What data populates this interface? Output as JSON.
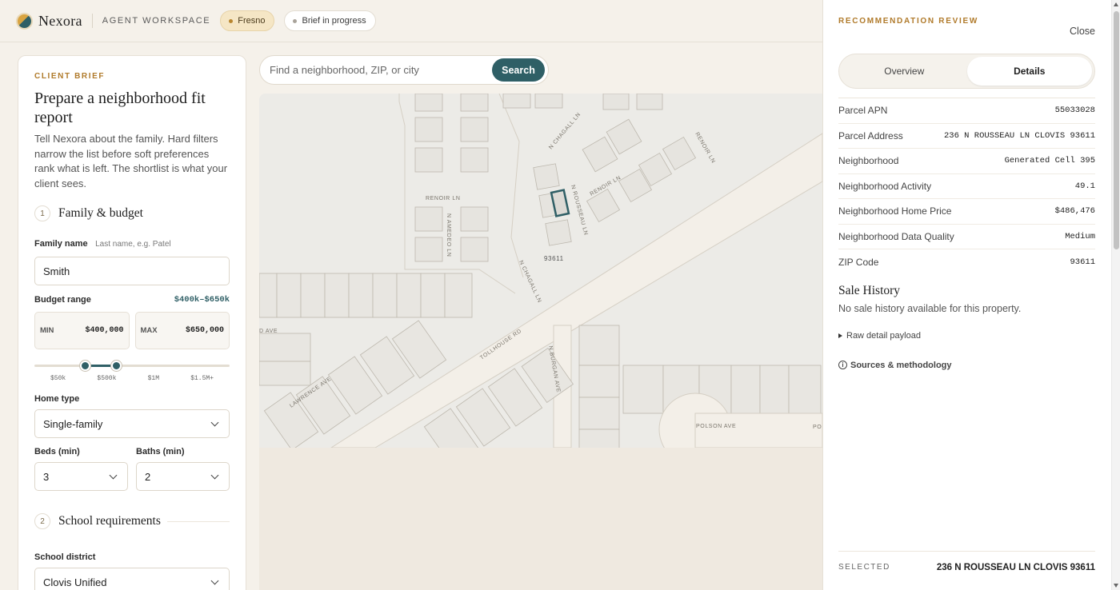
{
  "topbar": {
    "brand": "Nexora",
    "workspace": "AGENT WORKSPACE",
    "city_pill": "Fresno",
    "status_pill": "Brief in progress"
  },
  "brief": {
    "eyebrow": "CLIENT BRIEF",
    "title": "Prepare a neighborhood fit report",
    "description": "Tell Nexora about the family. Hard filters narrow the list before soft preferences rank what is left. The shortlist is what your client sees.",
    "section1": {
      "num": "1",
      "title": "Family & budget"
    },
    "family_name": {
      "label": "Family name",
      "hint": "Last name, e.g. Patel",
      "value": "Smith"
    },
    "budget": {
      "label": "Budget range",
      "summary": "$400k–$650k",
      "min_label": "MIN",
      "min_value": "$400,000",
      "max_label": "MAX",
      "max_value": "$650,000",
      "ticks": [
        "$50k",
        "$500k",
        "$1M",
        "$1.5M+"
      ]
    },
    "home_type": {
      "label": "Home type",
      "value": "Single-family"
    },
    "beds": {
      "label": "Beds (min)",
      "value": "3"
    },
    "baths": {
      "label": "Baths (min)",
      "value": "2"
    },
    "section2": {
      "num": "2",
      "title": "School requirements"
    },
    "school_district": {
      "label": "School district",
      "value": "Clovis Unified"
    }
  },
  "search": {
    "placeholder": "Find a neighborhood, ZIP, or city",
    "button": "Search"
  },
  "map": {
    "streets": [
      "RENOIR LN",
      "N AMEDEO LN",
      "N ROUSSEAU LN",
      "RENOIR LN",
      "RENOIR LN",
      "N CHAGALL LN",
      "N CHAGALL LN",
      "TOLLHOUSE RD",
      "LAWRENCE AVE",
      "N BURGAN AVE",
      "POLSON AVE",
      "PO",
      "D AVE"
    ],
    "zip_label": "93611"
  },
  "drawer": {
    "eyebrow": "RECOMMENDATION REVIEW",
    "close": "Close",
    "tabs": [
      "Overview",
      "Details"
    ],
    "active_tab": "Details",
    "details": [
      {
        "k": "Parcel APN",
        "v": "55033028"
      },
      {
        "k": "Parcel Address",
        "v": "236 N ROUSSEAU LN CLOVIS 93611"
      },
      {
        "k": "Neighborhood",
        "v": "Generated Cell 395"
      },
      {
        "k": "Neighborhood Activity",
        "v": "49.1"
      },
      {
        "k": "Neighborhood Home Price",
        "v": "$486,476"
      },
      {
        "k": "Neighborhood Data Quality",
        "v": "Medium"
      },
      {
        "k": "ZIP Code",
        "v": "93611"
      }
    ],
    "sale_history_title": "Sale History",
    "sale_history_text": "No sale history available for this property.",
    "raw_payload": "Raw detail payload",
    "sources": "Sources & methodology",
    "selected_label": "SELECTED",
    "selected_value": "236 N ROUSSEAU LN CLOVIS 93611"
  },
  "colors": {
    "accent": "#2f5f66",
    "eyebrow": "#b07a2a",
    "background": "#f5f1ea"
  }
}
